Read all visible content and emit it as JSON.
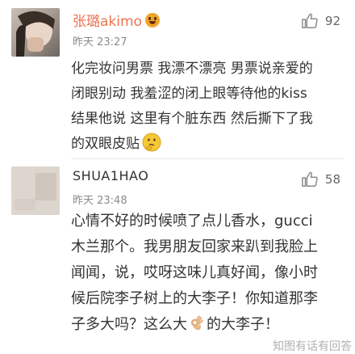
{
  "comments": [
    {
      "username": "张璐akimo",
      "time": "昨天 23:27",
      "likes": "92",
      "text": "化完妆问男票 我漂不漂亮 男票说亲爱的 闭眼别动 我羞涩的闭上眼等待他的kiss 结果他说 这里有个脏东西 然后撕下了我的双眼皮贴",
      "end_emoji": "thinking-face"
    },
    {
      "username": "SHUA1HAO",
      "time": "昨天 23:48",
      "likes": "58",
      "text_before": "心情不好的时候喷了点儿香水，gucci木兰那个。我男朋友回家来趴到我脸上闻闻，说，哎呀这味儿真好闻，像小时候后院李子树上的大李子！你知道那李子多大吗？这么大",
      "text_after": "的大李子！",
      "inline_emoji": "ok-hand"
    }
  ],
  "watermark": "知图有话有回答",
  "colors": {
    "vip_name": "#eb7350",
    "time": "#8a8a8a",
    "text": "#333333"
  }
}
